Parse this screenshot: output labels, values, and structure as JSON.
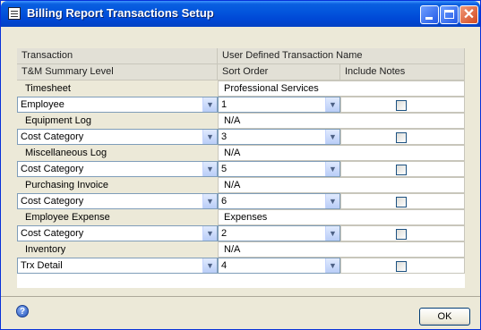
{
  "window": {
    "title": "Billing Report Transactions Setup"
  },
  "grid": {
    "headers": {
      "transaction": "Transaction",
      "user_defined_name": "User Defined Transaction Name",
      "summary_level": "T&M Summary Level",
      "sort_order": "Sort Order",
      "include_notes": "Include Notes"
    },
    "groups": [
      {
        "transaction": "Timesheet",
        "name": "Professional Services",
        "level": "Employee",
        "sort_order": "1",
        "include_notes": false
      },
      {
        "transaction": "Equipment Log",
        "name": "N/A",
        "level": "Cost Category",
        "sort_order": "3",
        "include_notes": false
      },
      {
        "transaction": "Miscellaneous Log",
        "name": "N/A",
        "level": "Cost Category",
        "sort_order": "5",
        "include_notes": false
      },
      {
        "transaction": "Purchasing Invoice",
        "name": "N/A",
        "level": "Cost Category",
        "sort_order": "6",
        "include_notes": false
      },
      {
        "transaction": "Employee Expense",
        "name": "Expenses",
        "level": "Cost Category",
        "sort_order": "2",
        "include_notes": false
      },
      {
        "transaction": "Inventory",
        "name": "N/A",
        "level": "Trx Detail",
        "sort_order": "4",
        "include_notes": false
      }
    ]
  },
  "footer": {
    "help_glyph": "?",
    "ok_label": "OK"
  },
  "colors": {
    "titlebar": "#0356dd",
    "window_bg": "#ece9d8"
  }
}
